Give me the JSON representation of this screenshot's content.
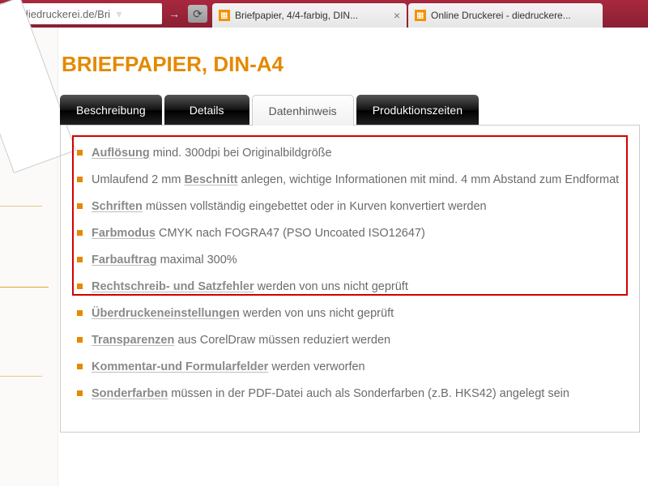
{
  "browser": {
    "url_display": "ww.diedruckerei.de/Bri",
    "tabs": [
      {
        "title": "Briefpapier, 4/4-farbig, DIN...",
        "active": true
      },
      {
        "title": "Online Druckerei - diedruckere...",
        "active": false
      }
    ]
  },
  "page": {
    "title": "BRIEFPAPIER, DIN-A4",
    "tabs": {
      "description": "Beschreibung",
      "details": "Details",
      "data_notice": "Datenhinweis",
      "production_times": "Produktionszeiten"
    },
    "items": [
      {
        "kw": "Auflösung",
        "rest": " mind. 300dpi bei Originalbildgröße"
      },
      {
        "pre": "Umlaufend 2 mm ",
        "kw": "Beschnitt",
        "rest": " anlegen, wichtige Informationen mit mind. 4 mm Abstand zum Endformat"
      },
      {
        "kw": "Schriften",
        "rest": " müssen vollständig eingebettet oder in Kurven konvertiert werden"
      },
      {
        "kw": "Farbmodus",
        "rest": " CMYK nach FOGRA47 (PSO Uncoated ISO12647)"
      },
      {
        "kw": "Farbauftrag",
        "rest": " maximal 300%"
      },
      {
        "kw": "Rechtschreib- und Satzfehler",
        "rest": " werden von uns nicht geprüft"
      },
      {
        "kw": "Überdruckeneinstellungen",
        "rest": " werden von uns nicht geprüft"
      },
      {
        "kw": "Transparenzen",
        "rest": " aus CorelDraw müssen reduziert werden"
      },
      {
        "kw": "Kommentar-und Formularfelder",
        "rest": " werden verworfen"
      },
      {
        "kw": "Sonderfarben",
        "rest": " müssen in der PDF-Datei auch als Sonderfarben (z.B. HKS42) angelegt sein"
      }
    ]
  }
}
